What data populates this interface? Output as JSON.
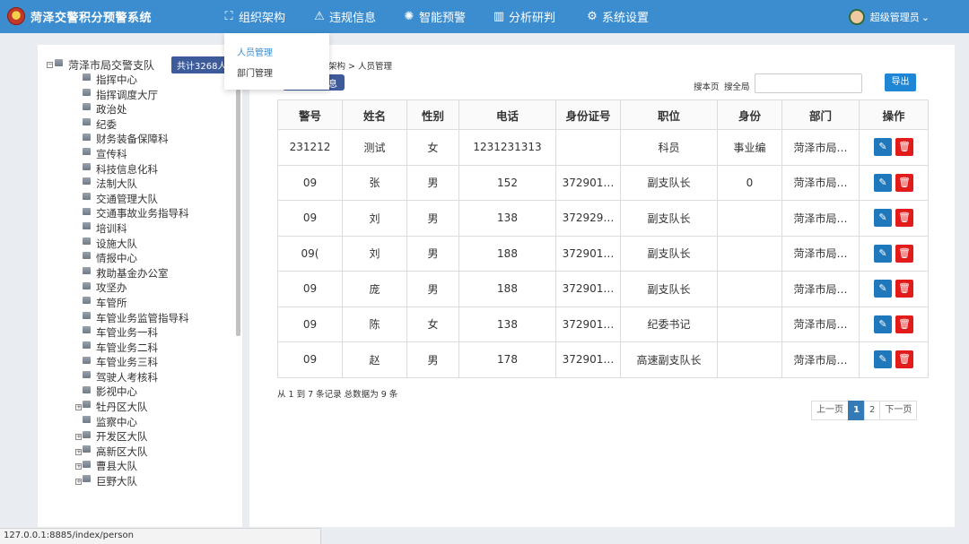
{
  "app": {
    "title": "菏泽交警积分预警系统"
  },
  "nav": [
    {
      "label": "组织架构",
      "icon": "org-structure-icon",
      "glyph": "⛶"
    },
    {
      "label": "违规信息",
      "icon": "warning-icon",
      "glyph": "⚠"
    },
    {
      "label": "智能预警",
      "icon": "alarm-icon",
      "glyph": "✺"
    },
    {
      "label": "分析研判",
      "icon": "bar-chart-icon",
      "glyph": "▥"
    },
    {
      "label": "系统设置",
      "icon": "gear-icon",
      "glyph": "⚙"
    }
  ],
  "user": {
    "name": "超级管理员",
    "caret": "⌄"
  },
  "dropdown": [
    {
      "label": "人员管理"
    },
    {
      "label": "部门管理"
    }
  ],
  "tree": {
    "root": "菏泽市局交警支队",
    "total": "共计3268人",
    "items": [
      {
        "label": "指挥中心",
        "expandable": false
      },
      {
        "label": "指挥调度大厅",
        "expandable": false
      },
      {
        "label": "政治处",
        "expandable": false
      },
      {
        "label": "纪委",
        "expandable": false
      },
      {
        "label": "财务装备保障科",
        "expandable": false
      },
      {
        "label": "宣传科",
        "expandable": false
      },
      {
        "label": "科技信息化科",
        "expandable": false
      },
      {
        "label": "法制大队",
        "expandable": false
      },
      {
        "label": "交通管理大队",
        "expandable": false
      },
      {
        "label": "交通事故业务指导科",
        "expandable": false
      },
      {
        "label": "培训科",
        "expandable": false
      },
      {
        "label": "设施大队",
        "expandable": false
      },
      {
        "label": "情报中心",
        "expandable": false
      },
      {
        "label": "救助基金办公室",
        "expandable": false
      },
      {
        "label": "攻坚办",
        "expandable": false
      },
      {
        "label": "车管所",
        "expandable": false
      },
      {
        "label": "车管业务监管指导科",
        "expandable": false
      },
      {
        "label": "车管业务一科",
        "expandable": false
      },
      {
        "label": "车管业务二科",
        "expandable": false
      },
      {
        "label": "车管业务三科",
        "expandable": false
      },
      {
        "label": "驾驶人考核科",
        "expandable": false
      },
      {
        "label": "影视中心",
        "expandable": false
      },
      {
        "label": "牡丹区大队",
        "expandable": true
      },
      {
        "label": "监察中心",
        "expandable": false
      },
      {
        "label": "开发区大队",
        "expandable": true
      },
      {
        "label": "高新区大队",
        "expandable": true
      },
      {
        "label": "曹县大队",
        "expandable": true
      },
      {
        "label": "巨野大队",
        "expandable": true
      }
    ]
  },
  "main": {
    "breadcrumb": "架构 > 人员管理",
    "info_button": "息",
    "search_page": "搜本页",
    "search_all": "搜全局",
    "search_value": "",
    "export": "导出",
    "columns": [
      "警号",
      "姓名",
      "性别",
      "电话",
      "身份证号",
      "职位",
      "身份",
      "部门",
      "操作"
    ],
    "rows": [
      [
        "231212",
        "测试",
        "女",
        "1231231313",
        "",
        "科员",
        "事业编",
        "菏泽市局…"
      ],
      [
        "09",
        "张",
        "男",
        "152",
        "372901…",
        "副支队长",
        "0",
        "菏泽市局…"
      ],
      [
        "09",
        "刘",
        "男",
        "138",
        "372929…",
        "副支队长",
        "",
        "菏泽市局…"
      ],
      [
        "09(",
        "刘",
        "男",
        "188",
        "372901…",
        "副支队长",
        "",
        "菏泽市局…"
      ],
      [
        "09",
        "庞",
        "男",
        "188",
        "372901…",
        "副支队长",
        "",
        "菏泽市局…"
      ],
      [
        "09",
        "陈",
        "女",
        "138",
        "372901…",
        "纪委书记",
        "",
        "菏泽市局…"
      ],
      [
        "09",
        "赵",
        "男",
        "178",
        "372901…",
        "高速副支队长",
        "",
        "菏泽市局…"
      ]
    ],
    "records": "从 1 到 7 条记录 总数据为 9 条",
    "pager": {
      "prev": "上一页",
      "pages": [
        "1",
        "2"
      ],
      "current": "1",
      "next": "下一页"
    }
  },
  "status_url": "127.0.0.1:8885/index/person",
  "colors": {
    "nav_bg": "#3c8dcf",
    "badge": "#3d5a9b",
    "edit": "#1f78bb",
    "delete": "#e21b1b",
    "pager_active": "#337ab7"
  }
}
